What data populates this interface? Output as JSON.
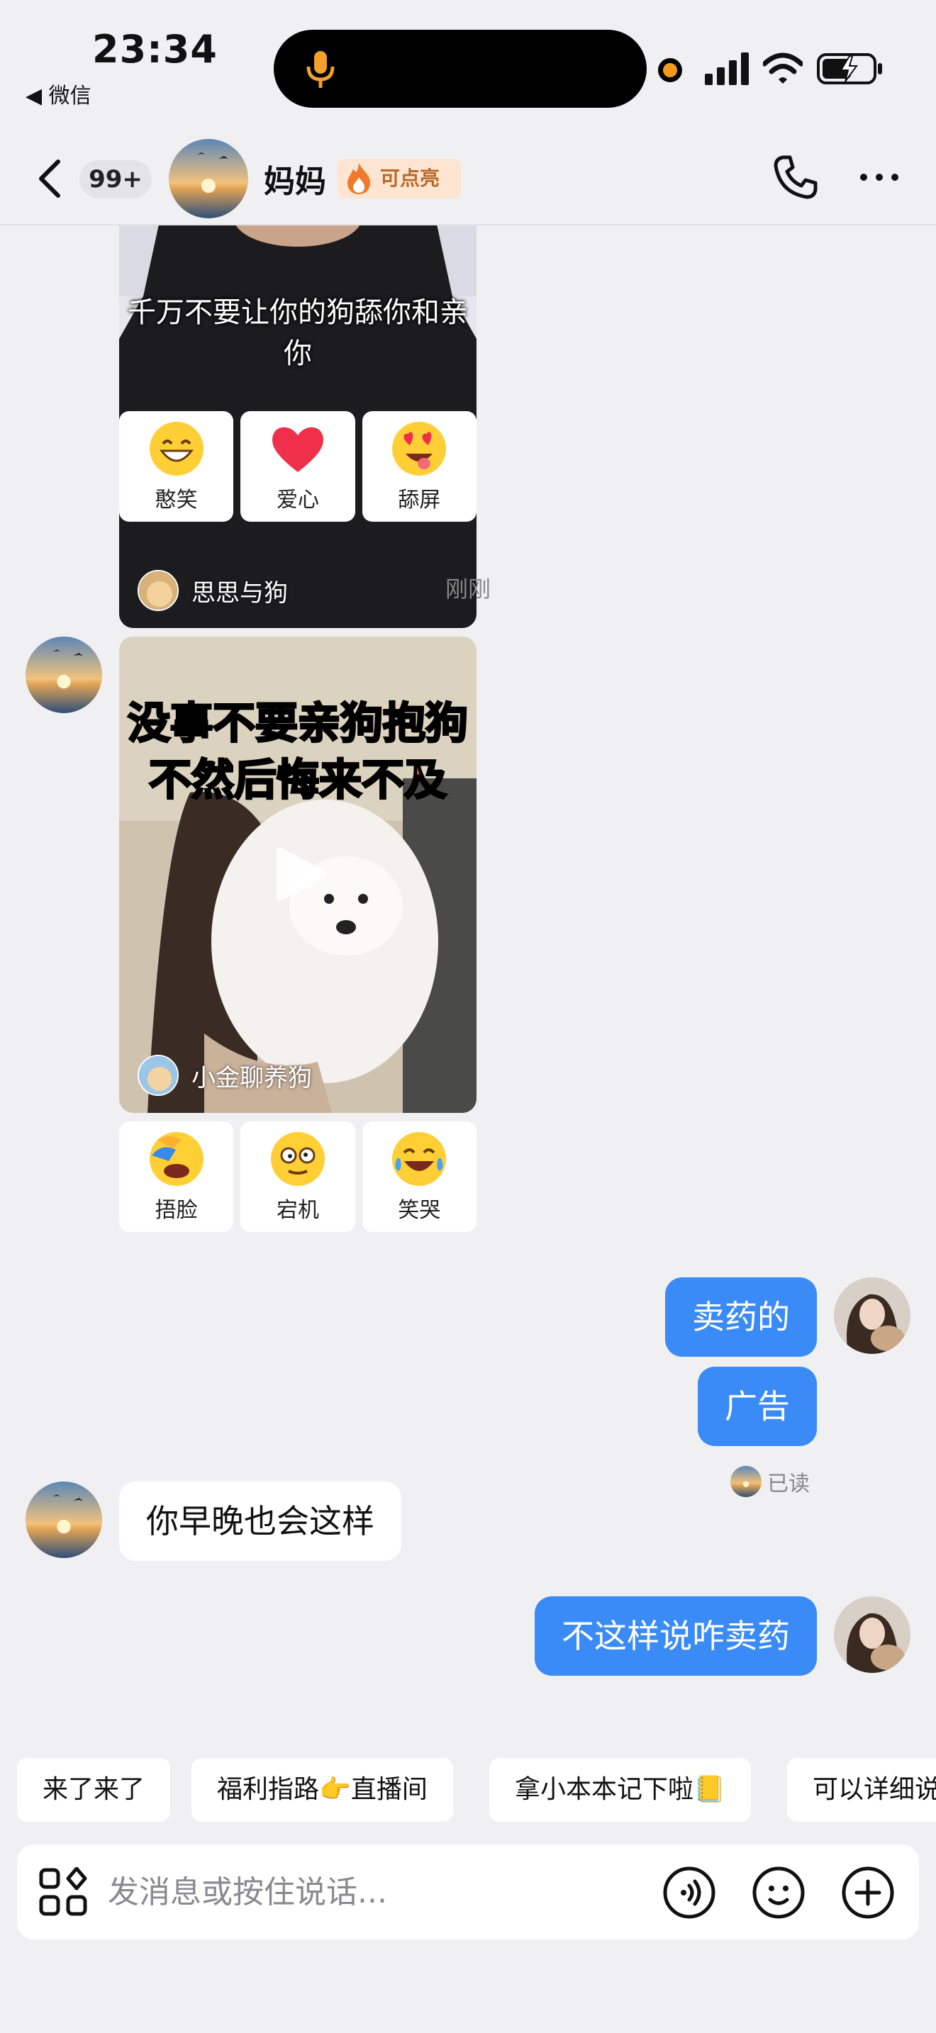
{
  "status_bar": {
    "time": "23:34",
    "back_app": "◀ 微信"
  },
  "header": {
    "unread_count": "99+",
    "contact_name": "妈妈",
    "spark_label": "可点亮"
  },
  "messages": {
    "video1": {
      "caption": "千万不要让你的狗舔你和亲你",
      "author": "思思与狗"
    },
    "reactions1": [
      {
        "label": "憨笑",
        "icon": "grin-emoji-icon"
      },
      {
        "label": "爱心",
        "icon": "heart-emoji-icon"
      },
      {
        "label": "舔屏",
        "icon": "heart-eyes-emoji-icon"
      }
    ],
    "time_divider": "刚刚",
    "video2": {
      "title_line1": "没事不要亲狗抱狗",
      "title_line2": "不然后悔来不及",
      "author": "小金聊养狗"
    },
    "reactions2": [
      {
        "label": "捂脸",
        "icon": "facepalm-emoji-icon"
      },
      {
        "label": "宕机",
        "icon": "dazed-emoji-icon"
      },
      {
        "label": "笑哭",
        "icon": "laugh-cry-emoji-icon"
      }
    ],
    "outgoing1": "卖药的",
    "outgoing2": "广告",
    "incoming1": "你早晚也会这样",
    "outgoing3": "不这样说咋卖药",
    "read_status": "已读"
  },
  "quick_replies": [
    "来了来了",
    "福利指路👉直播间",
    "拿小本本记下啦📒",
    "可以详细说"
  ],
  "input": {
    "placeholder": "发消息或按住说话..."
  },
  "colors": {
    "outgoing_bubble": "#3a8bf6",
    "background": "#f0f0f2",
    "spark_badge_bg": "#fde5d2",
    "spark_text": "#b86a2a"
  }
}
